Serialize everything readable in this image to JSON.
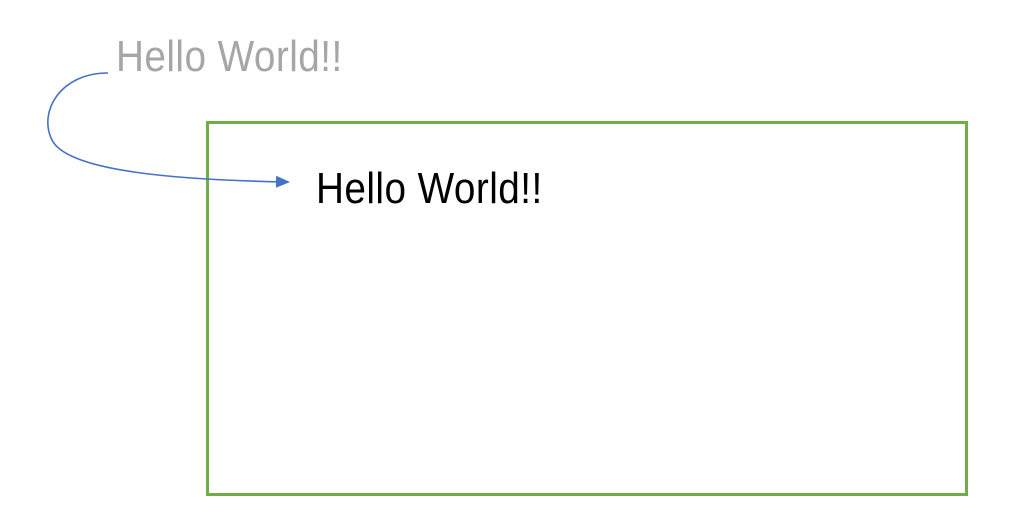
{
  "diagram": {
    "source_label": "Hello World!!",
    "target_label": "Hello World!!"
  },
  "colors": {
    "source_text": "#a6a6a6",
    "target_text": "#000000",
    "frame_border": "#70ad47",
    "connector": "#4472c4"
  }
}
